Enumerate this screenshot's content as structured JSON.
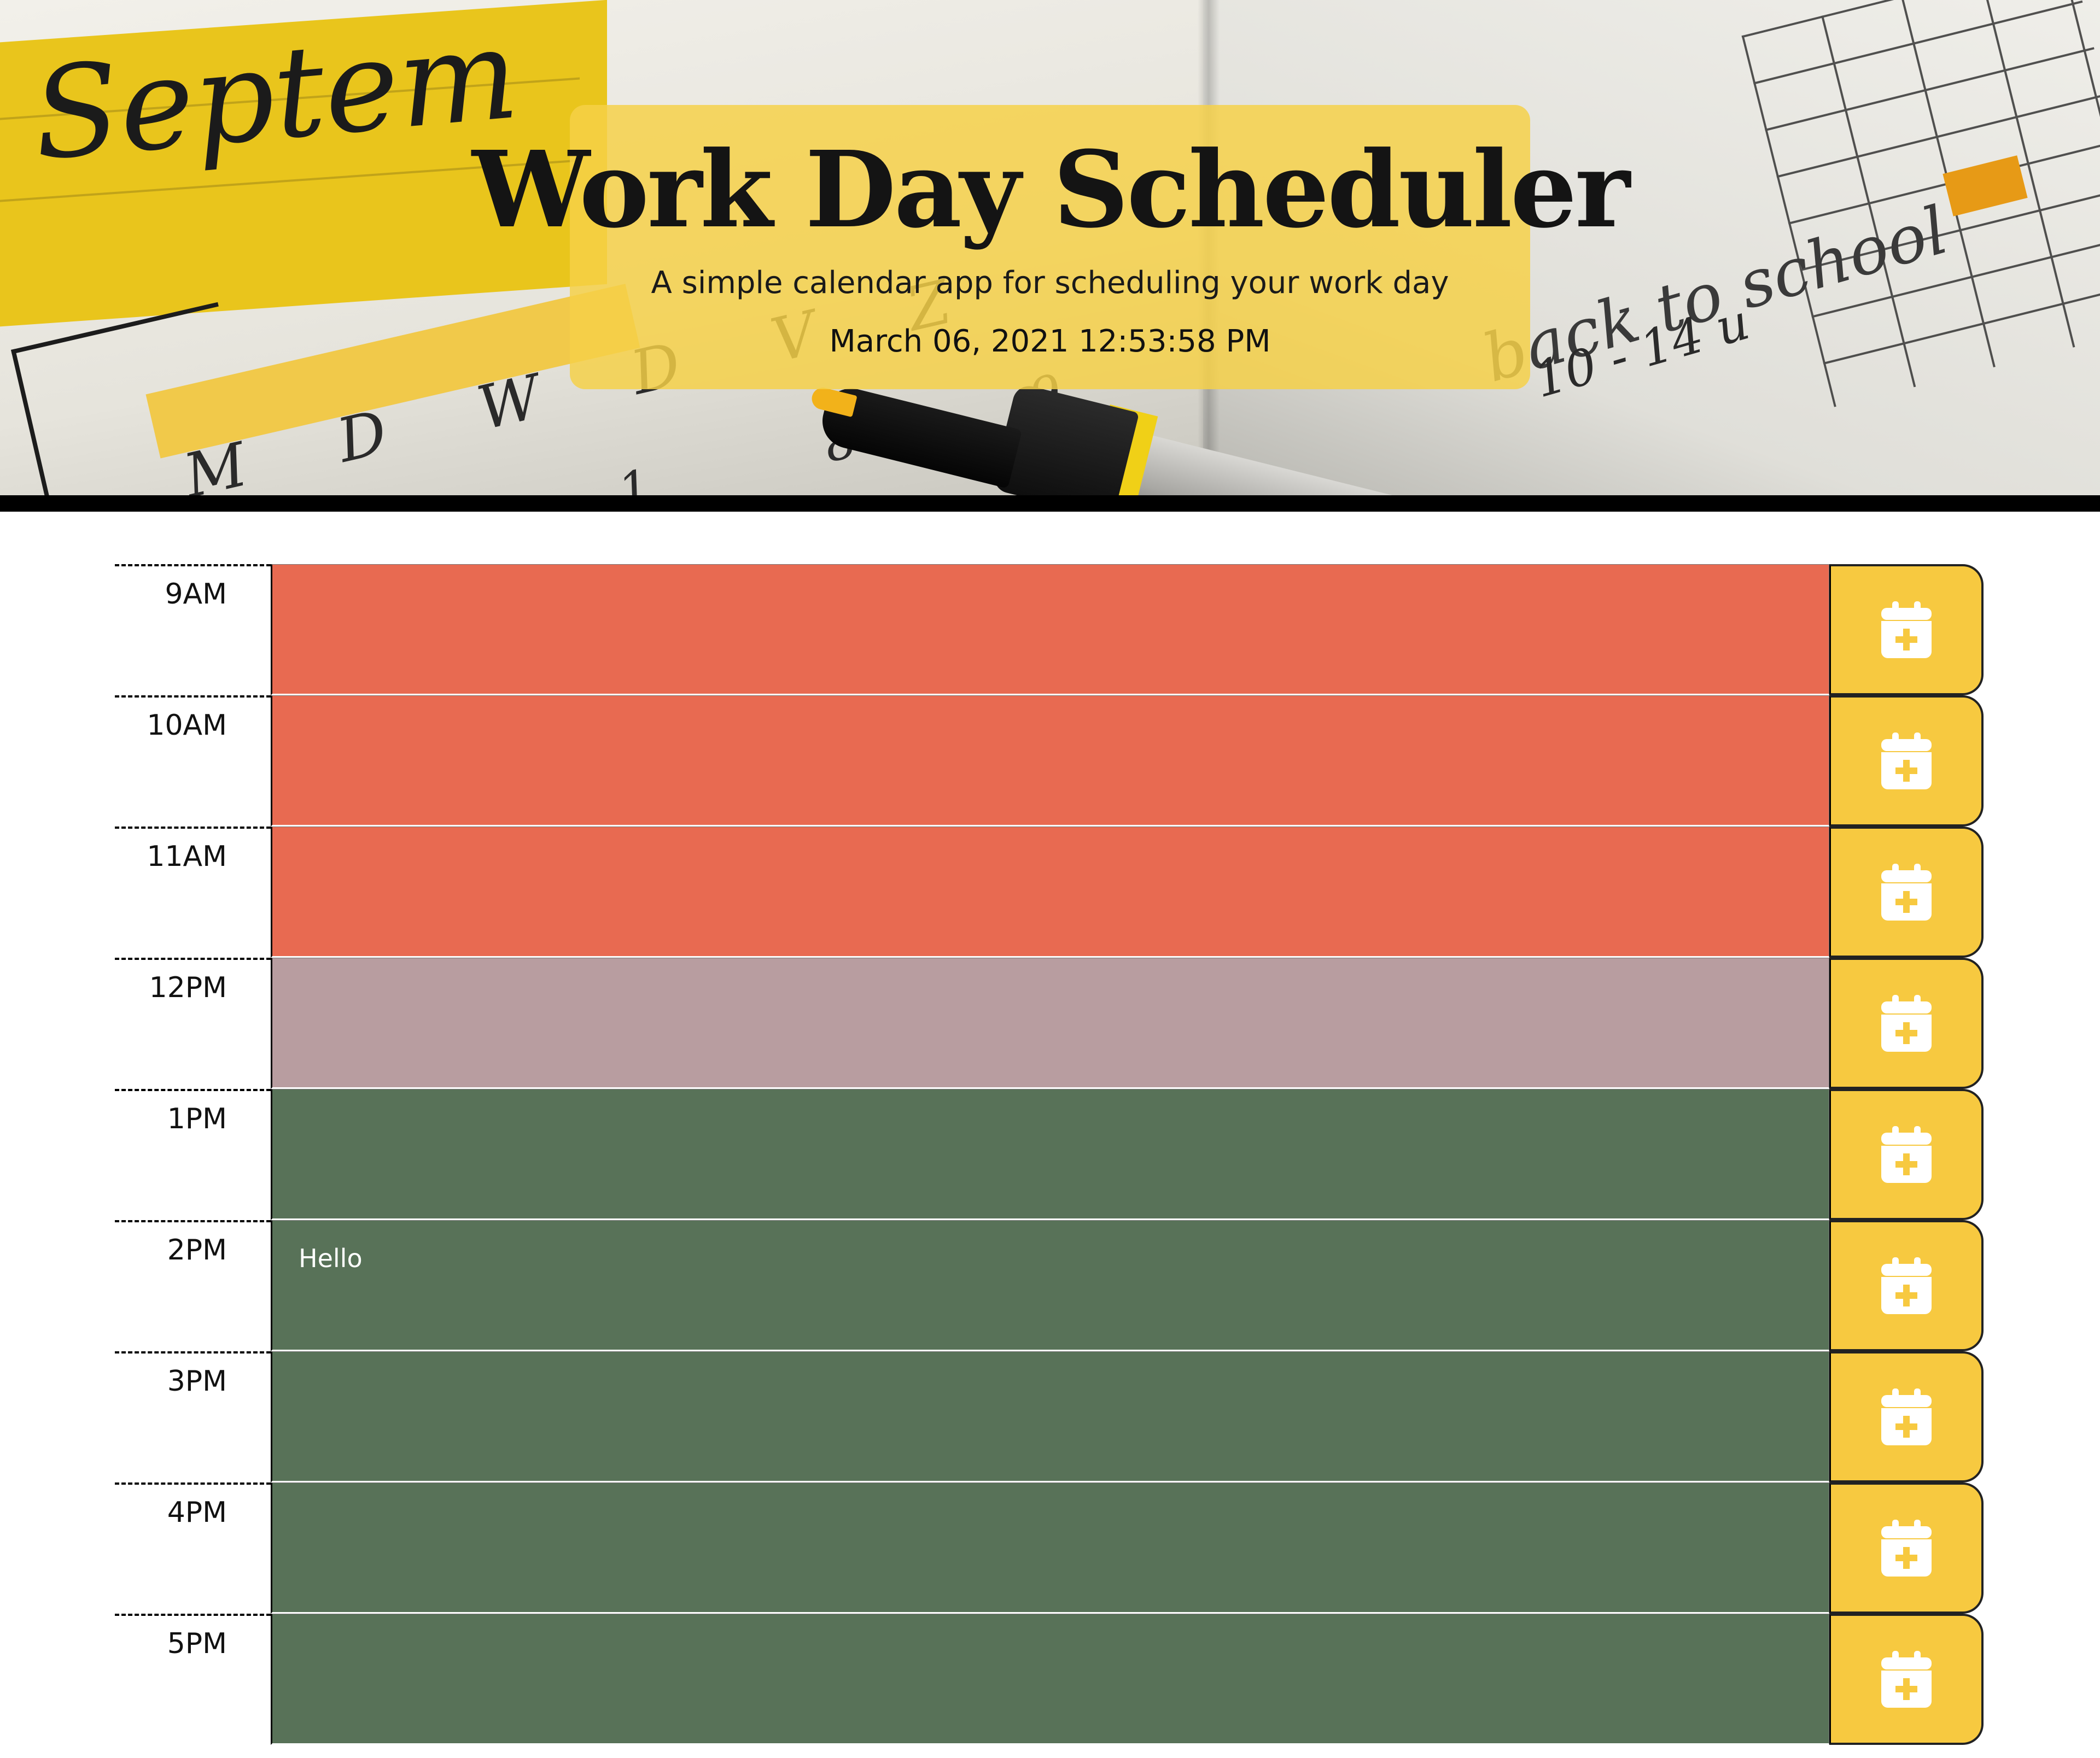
{
  "header": {
    "title": "Work Day Scheduler",
    "subtitle": "A simple calendar app for scheduling your work day",
    "current_datetime": "March 06, 2021 12:53:58 PM"
  },
  "hero_text": {
    "month": "Septem",
    "back_to_school": "back to school",
    "date_range": "10 - 14 u",
    "day_letters": "M D W D V Z",
    "numbers": "1 8 9"
  },
  "colors": {
    "past": "#e86a51",
    "present": "#b89da0",
    "future": "#587258",
    "save_button": "#f7c940",
    "title_card": "#f6d048"
  },
  "save_icon": "calendar-plus-icon",
  "time_blocks": [
    {
      "hour": "9AM",
      "status": "past",
      "text": ""
    },
    {
      "hour": "10AM",
      "status": "past",
      "text": ""
    },
    {
      "hour": "11AM",
      "status": "past",
      "text": ""
    },
    {
      "hour": "12PM",
      "status": "present",
      "text": ""
    },
    {
      "hour": "1PM",
      "status": "future",
      "text": ""
    },
    {
      "hour": "2PM",
      "status": "future",
      "text": "Hello"
    },
    {
      "hour": "3PM",
      "status": "future",
      "text": ""
    },
    {
      "hour": "4PM",
      "status": "future",
      "text": ""
    },
    {
      "hour": "5PM",
      "status": "future",
      "text": ""
    }
  ]
}
